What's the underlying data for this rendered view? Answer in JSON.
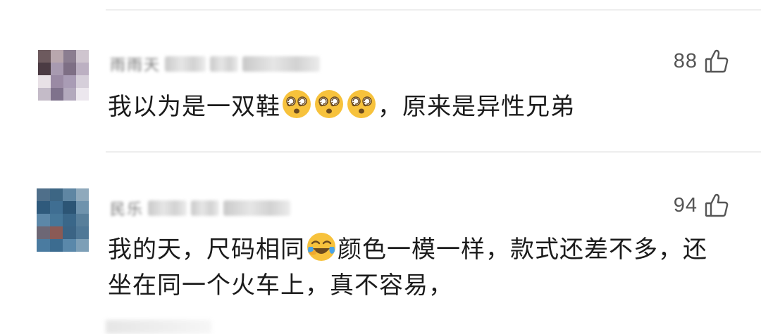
{
  "comments": [
    {
      "username": "雨雨天",
      "likes": "88",
      "text_before": "我以为是一双鞋",
      "text_after": "，原来是异性兄弟",
      "emojis": [
        "dizzy-face-emoji",
        "dizzy-face-emoji",
        "dizzy-face-emoji"
      ]
    },
    {
      "username": "民乐",
      "likes": "94",
      "text_before": "我的天，尺码相同",
      "text_after": "颜色一模一样，款式还差不多，还坐在同一个火车上，真不容易，",
      "emojis": [
        "laughing-crying-emoji"
      ]
    }
  ],
  "icons": {
    "like": "thumbs-up-icon"
  },
  "colors": {
    "text": "#1b1b1b",
    "count": "#555555",
    "divider": "#eeeeee",
    "emoji_face": "#f7c23c"
  }
}
